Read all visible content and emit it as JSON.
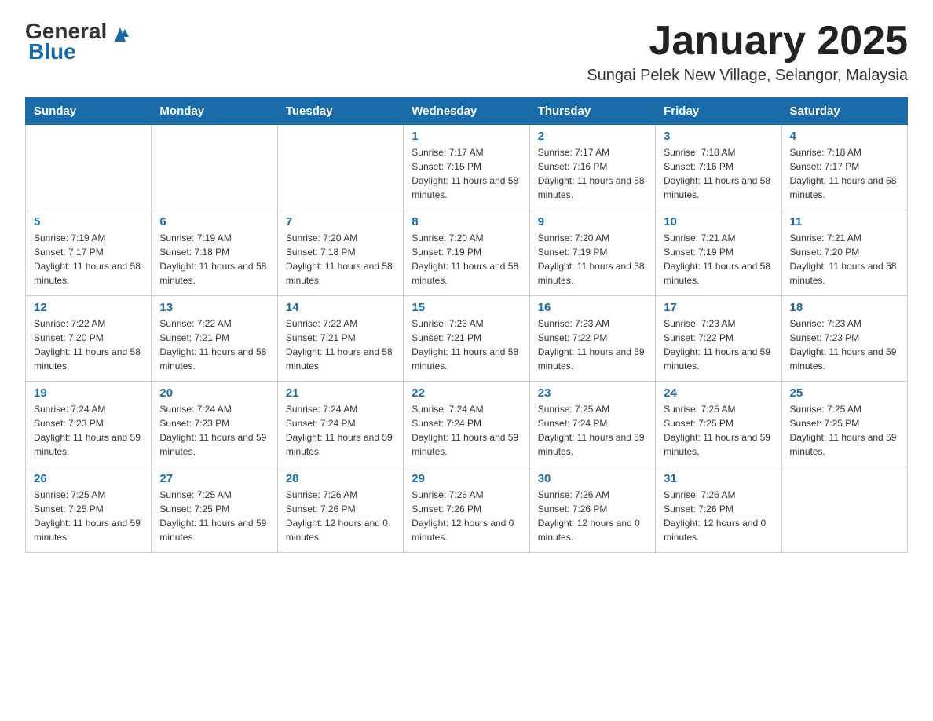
{
  "header": {
    "logo_general": "General",
    "logo_blue": "Blue",
    "month_title": "January 2025",
    "location": "Sungai Pelek New Village, Selangor, Malaysia"
  },
  "days_of_week": [
    "Sunday",
    "Monday",
    "Tuesday",
    "Wednesday",
    "Thursday",
    "Friday",
    "Saturday"
  ],
  "weeks": [
    [
      {
        "day": "",
        "info": ""
      },
      {
        "day": "",
        "info": ""
      },
      {
        "day": "",
        "info": ""
      },
      {
        "day": "1",
        "info": "Sunrise: 7:17 AM\nSunset: 7:15 PM\nDaylight: 11 hours and 58 minutes."
      },
      {
        "day": "2",
        "info": "Sunrise: 7:17 AM\nSunset: 7:16 PM\nDaylight: 11 hours and 58 minutes."
      },
      {
        "day": "3",
        "info": "Sunrise: 7:18 AM\nSunset: 7:16 PM\nDaylight: 11 hours and 58 minutes."
      },
      {
        "day": "4",
        "info": "Sunrise: 7:18 AM\nSunset: 7:17 PM\nDaylight: 11 hours and 58 minutes."
      }
    ],
    [
      {
        "day": "5",
        "info": "Sunrise: 7:19 AM\nSunset: 7:17 PM\nDaylight: 11 hours and 58 minutes."
      },
      {
        "day": "6",
        "info": "Sunrise: 7:19 AM\nSunset: 7:18 PM\nDaylight: 11 hours and 58 minutes."
      },
      {
        "day": "7",
        "info": "Sunrise: 7:20 AM\nSunset: 7:18 PM\nDaylight: 11 hours and 58 minutes."
      },
      {
        "day": "8",
        "info": "Sunrise: 7:20 AM\nSunset: 7:19 PM\nDaylight: 11 hours and 58 minutes."
      },
      {
        "day": "9",
        "info": "Sunrise: 7:20 AM\nSunset: 7:19 PM\nDaylight: 11 hours and 58 minutes."
      },
      {
        "day": "10",
        "info": "Sunrise: 7:21 AM\nSunset: 7:19 PM\nDaylight: 11 hours and 58 minutes."
      },
      {
        "day": "11",
        "info": "Sunrise: 7:21 AM\nSunset: 7:20 PM\nDaylight: 11 hours and 58 minutes."
      }
    ],
    [
      {
        "day": "12",
        "info": "Sunrise: 7:22 AM\nSunset: 7:20 PM\nDaylight: 11 hours and 58 minutes."
      },
      {
        "day": "13",
        "info": "Sunrise: 7:22 AM\nSunset: 7:21 PM\nDaylight: 11 hours and 58 minutes."
      },
      {
        "day": "14",
        "info": "Sunrise: 7:22 AM\nSunset: 7:21 PM\nDaylight: 11 hours and 58 minutes."
      },
      {
        "day": "15",
        "info": "Sunrise: 7:23 AM\nSunset: 7:21 PM\nDaylight: 11 hours and 58 minutes."
      },
      {
        "day": "16",
        "info": "Sunrise: 7:23 AM\nSunset: 7:22 PM\nDaylight: 11 hours and 59 minutes."
      },
      {
        "day": "17",
        "info": "Sunrise: 7:23 AM\nSunset: 7:22 PM\nDaylight: 11 hours and 59 minutes."
      },
      {
        "day": "18",
        "info": "Sunrise: 7:23 AM\nSunset: 7:23 PM\nDaylight: 11 hours and 59 minutes."
      }
    ],
    [
      {
        "day": "19",
        "info": "Sunrise: 7:24 AM\nSunset: 7:23 PM\nDaylight: 11 hours and 59 minutes."
      },
      {
        "day": "20",
        "info": "Sunrise: 7:24 AM\nSunset: 7:23 PM\nDaylight: 11 hours and 59 minutes."
      },
      {
        "day": "21",
        "info": "Sunrise: 7:24 AM\nSunset: 7:24 PM\nDaylight: 11 hours and 59 minutes."
      },
      {
        "day": "22",
        "info": "Sunrise: 7:24 AM\nSunset: 7:24 PM\nDaylight: 11 hours and 59 minutes."
      },
      {
        "day": "23",
        "info": "Sunrise: 7:25 AM\nSunset: 7:24 PM\nDaylight: 11 hours and 59 minutes."
      },
      {
        "day": "24",
        "info": "Sunrise: 7:25 AM\nSunset: 7:25 PM\nDaylight: 11 hours and 59 minutes."
      },
      {
        "day": "25",
        "info": "Sunrise: 7:25 AM\nSunset: 7:25 PM\nDaylight: 11 hours and 59 minutes."
      }
    ],
    [
      {
        "day": "26",
        "info": "Sunrise: 7:25 AM\nSunset: 7:25 PM\nDaylight: 11 hours and 59 minutes."
      },
      {
        "day": "27",
        "info": "Sunrise: 7:25 AM\nSunset: 7:25 PM\nDaylight: 11 hours and 59 minutes."
      },
      {
        "day": "28",
        "info": "Sunrise: 7:26 AM\nSunset: 7:26 PM\nDaylight: 12 hours and 0 minutes."
      },
      {
        "day": "29",
        "info": "Sunrise: 7:26 AM\nSunset: 7:26 PM\nDaylight: 12 hours and 0 minutes."
      },
      {
        "day": "30",
        "info": "Sunrise: 7:26 AM\nSunset: 7:26 PM\nDaylight: 12 hours and 0 minutes."
      },
      {
        "day": "31",
        "info": "Sunrise: 7:26 AM\nSunset: 7:26 PM\nDaylight: 12 hours and 0 minutes."
      },
      {
        "day": "",
        "info": ""
      }
    ]
  ]
}
